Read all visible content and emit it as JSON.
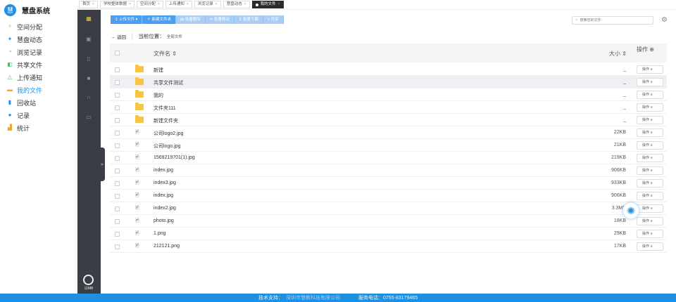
{
  "app": {
    "logo_char": "慧",
    "title": "慧盘系统"
  },
  "sidebar": {
    "items": [
      {
        "label": "空间分配",
        "icon": "lightning-icon",
        "glyph": "⚡",
        "color": "#f5a623"
      },
      {
        "label": "慧盘动态",
        "icon": "star-icon",
        "glyph": "✦",
        "color": "#1f8fe0"
      },
      {
        "label": "浏览记录",
        "icon": "clock-icon",
        "glyph": "◔",
        "color": "#3cbf6a"
      },
      {
        "label": "共享文件",
        "icon": "share-icon",
        "glyph": "◧",
        "color": "#3cbf6a"
      },
      {
        "label": "上传通知",
        "icon": "bell-icon",
        "glyph": "△",
        "color": "#3cbf6a"
      },
      {
        "label": "我的文件",
        "icon": "folder-icon",
        "glyph": "▬",
        "color": "#f5a623"
      },
      {
        "label": "回收站",
        "icon": "trash-icon",
        "glyph": "▮",
        "color": "#1f8fe0"
      },
      {
        "label": "记录",
        "icon": "record-icon",
        "glyph": "●",
        "color": "#1f8fe0"
      },
      {
        "label": "统计",
        "icon": "chart-icon",
        "glyph": "▟",
        "color": "#f5a623"
      }
    ],
    "active_index": 5
  },
  "tabs": [
    {
      "label": "首页"
    },
    {
      "label": "学校整体数据"
    },
    {
      "label": "空间分配"
    },
    {
      "label": "上传通知"
    },
    {
      "label": "浏览记录"
    },
    {
      "label": "慧盘动态"
    },
    {
      "label": "我的文件",
      "active": true
    }
  ],
  "toolbar": {
    "upload": "↥ 上传文件 ▾",
    "new_folder": "＋ 新建文件夹",
    "batch_delete": "▤ 批量删除",
    "batch_move": "✛ 批量移动",
    "batch_download": "↧ 批量下载",
    "share": "< 共享"
  },
  "search": {
    "placeholder": "搜索您的文件"
  },
  "breadcrumb": {
    "back": "← 返回",
    "location_label": "当前位置：",
    "path": "全部文件"
  },
  "table": {
    "col_name": "文件名 ⇕",
    "col_size": "大小 ⇕",
    "col_op": "操作 ⊕",
    "rows": [
      {
        "name": "新建",
        "size": "_",
        "type": "folder"
      },
      {
        "name": "共享文件测试",
        "size": "_",
        "type": "folder"
      },
      {
        "name": "我的",
        "size": "_",
        "type": "folder"
      },
      {
        "name": "文件夹111",
        "size": "_",
        "type": "folder"
      },
      {
        "name": "新建文件夹",
        "size": "_",
        "type": "folder"
      },
      {
        "name": "公司logo2.jpg",
        "size": "22KB",
        "type": "image"
      },
      {
        "name": "公司logo.jpg",
        "size": "21KB",
        "type": "image"
      },
      {
        "name": "1569219701(1).jpg",
        "size": "219KB",
        "type": "image"
      },
      {
        "name": "index.jpg",
        "size": "906KB",
        "type": "image"
      },
      {
        "name": "index3.jpg",
        "size": "933KB",
        "type": "image"
      },
      {
        "name": "index.jpg",
        "size": "906KB",
        "type": "image"
      },
      {
        "name": "index2.jpg",
        "size": "3.3MB",
        "type": "image"
      },
      {
        "name": "photo.jpg",
        "size": "18KB",
        "type": "image"
      },
      {
        "name": "1.png",
        "size": "29KB",
        "type": "image"
      },
      {
        "name": "212121.png",
        "size": "17KB",
        "type": "image"
      }
    ],
    "op_label": "操作 ∨"
  },
  "storage": {
    "used": "11MB"
  },
  "footer": {
    "support_label": "技术支持：",
    "support_company": "深圳市慧教科技有限公司",
    "phone": "服务电话：0755-83179465"
  }
}
